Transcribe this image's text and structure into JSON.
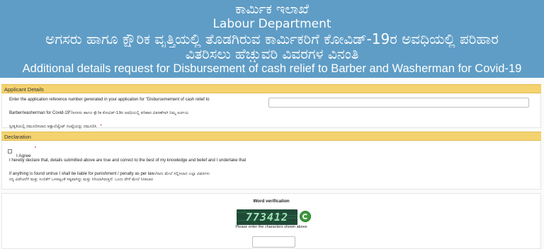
{
  "header": {
    "line1": "ಕಾರ್ಮಿಕ ಇಲಾಖೆ",
    "line2": "Labour Department",
    "line3": "ಅಗಸರು ಹಾಗೂ ಕ್ಷೌರಿಕ ವೃತ್ತಿಯಲ್ಲಿ ತೊಡಗಿರುವ ಕಾರ್ಮಿಕರಿಗೆ ಕೋವಿಡ್-19ರ ಅವಧಿಯಲ್ಲಿ ಪರಿಹಾರ",
    "line4": "ವಿತರಿಸಲು ಹೆಚ್ಚುವರಿ ವಿವರಗಳ ವಿನಂತಿ",
    "line5": "Additional details request for Disbursement of cash relief to Barber and Washerman for Covid-19"
  },
  "applicant": {
    "section_title": "Applicant Details",
    "label_en_1": "Enter the application reference number generated in your application for \"Disbursemement of cash relief to",
    "label_en_2": "Barber/washerman for Covid-19\"/",
    "label_kn_1": "ಅಗಸರು ಹಾಗೂ ಕ್ಷೌರಿಕ ಕೋವಿಡ್-19ರ ಅವಧಿಯಲ್ಲಿ ಪರಿಹಾರ ವಿತರಣೆಗಾಗಿ ನಿಮ್ಮ ಅರ್ಜಿಯ",
    "label_kn_2": "ಸ್ವೀಕೃತಿಯಲ್ಲಿ ನಮೂದಿಸಲಾದ ಅಕ್ನಾಲೆಜ್ಮೆಂಟ್ ಸಂಖ್ಯೆಯನ್ನು ನಮೂದಿಸಿ",
    "required_mark": "*",
    "reference_value": ""
  },
  "declaration": {
    "section_title": "Declaration",
    "agree_label": "I Agree",
    "required_mark": "*",
    "text_en_1": "I hereby declare that, details submitted above are true and correct to the best of my knowledge and belief and I undertake that",
    "text_en_2": "if anything is found untrue I shall be liable for punishment / penalty as per law./",
    "text_kn_1": "ನಾನು ಮೇಲೆ ಸಲ್ಲಿಸಲಾದ ಎಲ್ಲಾ ವಿವರಗಳು",
    "text_kn_2": "ನನ್ನ ವಿವೇಚನೆಗೆ ಮತ್ತು ನಂಬಿಕೆಗೆ ಒಳಪಟ್ಟಂತೆ ಸತ್ಯವಾಗಿದ್ದು ಮತ್ತು ಸರಿಯಾಗಿರುತ್ತದೆ. ಒಂದು ವೇಳೆ ಮೇಲೆ ನೀಡಲಾದ"
  },
  "verification": {
    "title": "Word verification",
    "captcha_text": "773412",
    "instruction": "Please enter the characters shown above",
    "input_value": ""
  }
}
